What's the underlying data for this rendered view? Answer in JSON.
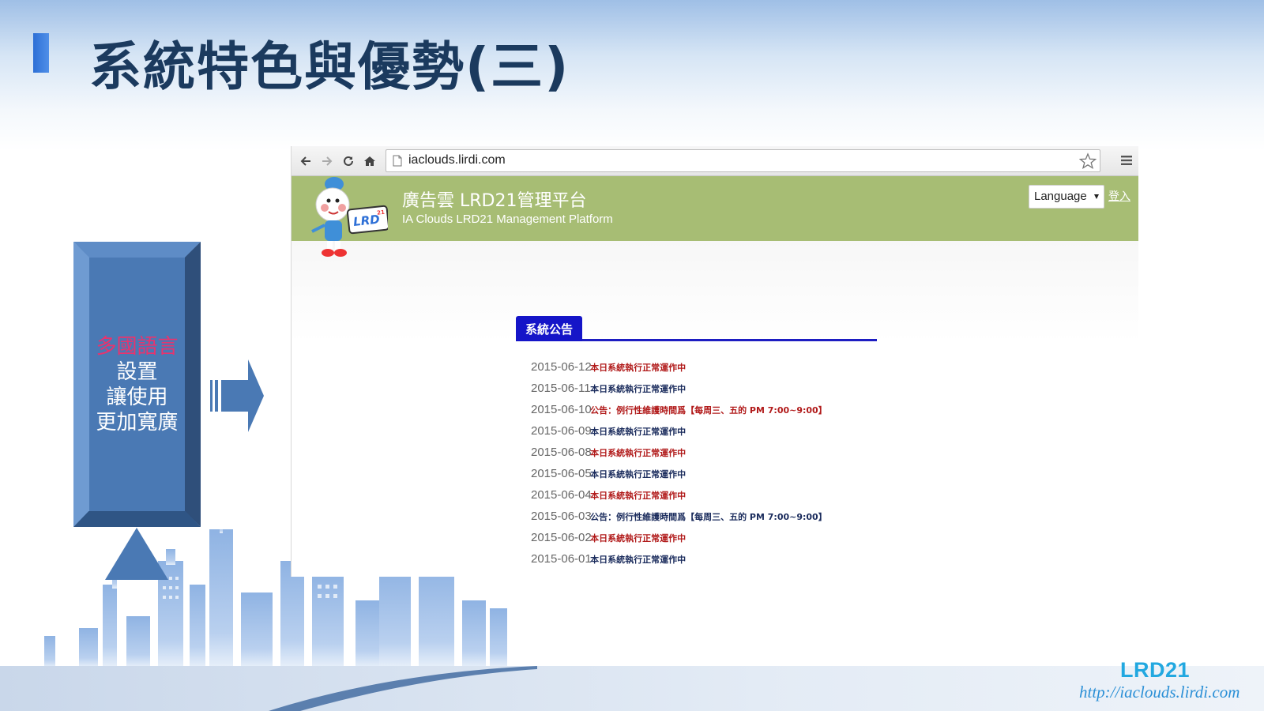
{
  "slide": {
    "title": "系統特色與優勢(三)",
    "feature_box": {
      "highlight": "多國語言",
      "lines": [
        "設置",
        "讓使用",
        "更加寬廣"
      ]
    },
    "brand_name": "LRD21",
    "brand_url": "http://iaclouds.lirdi.com",
    "colors": {
      "title": "#1b3a5e",
      "feature_box": "#4a79b4",
      "highlight": "#e8336e",
      "brand": "#22a8e0"
    }
  },
  "browser": {
    "url": "iaclouds.lirdi.com",
    "toolbar_icons": [
      "back-arrow-icon",
      "forward-arrow-icon",
      "reload-icon",
      "home-icon",
      "page-icon",
      "bookmark-star-icon",
      "menu-icon"
    ],
    "site": {
      "title": "廣告雲 LRD21管理平台",
      "subtitle": "IA Clouds LRD21 Management Platform",
      "logo_text": "LRD",
      "logo_superscript": "21",
      "language_selected": "Language",
      "login_label": "登入",
      "header_color": "#a7bd74"
    },
    "announcements": {
      "tab_label": "系統公告",
      "tab_color": "#1515c8",
      "items": [
        {
          "date": "2015-06-12",
          "text": "本日系統執行正常運作中",
          "color": "red"
        },
        {
          "date": "2015-06-11",
          "text": "本日系統執行正常運作中",
          "color": "navy"
        },
        {
          "date": "2015-06-10",
          "text": "公告：例行性維護時間爲【每周三、五的 PM 7:00~9:00】",
          "color": "red"
        },
        {
          "date": "2015-06-09",
          "text": "本日系統執行正常運作中",
          "color": "navy"
        },
        {
          "date": "2015-06-08",
          "text": "本日系統執行正常運作中",
          "color": "red"
        },
        {
          "date": "2015-06-05",
          "text": "本日系統執行正常運作中",
          "color": "navy"
        },
        {
          "date": "2015-06-04",
          "text": "本日系統執行正常運作中",
          "color": "red"
        },
        {
          "date": "2015-06-03",
          "text": "公告：例行性維護時間爲【每周三、五的 PM 7:00~9:00】",
          "color": "navy"
        },
        {
          "date": "2015-06-02",
          "text": "本日系統執行正常運作中",
          "color": "red"
        },
        {
          "date": "2015-06-01",
          "text": "本日系統執行正常運作中",
          "color": "navy"
        }
      ]
    }
  }
}
